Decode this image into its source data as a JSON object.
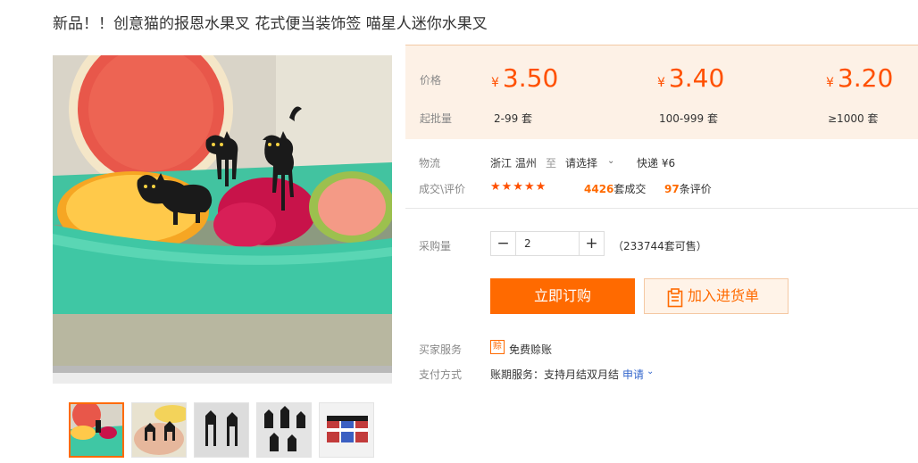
{
  "product": {
    "title": "新品！！创意猫的报恩水果叉 花式便当装饰签 喵星人迷你水果叉"
  },
  "gallery": {
    "thumbnails": [
      "thumb-1",
      "thumb-2",
      "thumb-3",
      "thumb-4",
      "thumb-5"
    ],
    "active_index": 0
  },
  "price_box": {
    "price_label": "价格",
    "moq_label": "起批量",
    "currency": "¥",
    "tiers": [
      {
        "price": "3.50",
        "range": "2-99 套"
      },
      {
        "price": "3.40",
        "range": "100-999 套"
      },
      {
        "price": "3.20",
        "range": "≥1000 套"
      }
    ]
  },
  "logistics": {
    "label": "物流",
    "origin": "浙江 温州",
    "to": "至",
    "destination": "请选择",
    "shipping": "快递 ¥6"
  },
  "sales": {
    "label": "成交\\评价",
    "rating_stars": 5,
    "sold_count": "4426",
    "sold_suffix": "套成交",
    "review_count": "97",
    "review_suffix": "条评价"
  },
  "purchase": {
    "label": "采购量",
    "minus": "−",
    "plus": "+",
    "quantity": "2",
    "stock_text": "（233744套可售）"
  },
  "actions": {
    "buy_now": "立即订购",
    "add_to_list": "加入进货单"
  },
  "services": {
    "buyer_label": "买家服务",
    "badge": "赊",
    "buyer_service": "免费赊账",
    "payment_label": "支付方式",
    "payment_text": "账期服务：支持月结双月结",
    "apply_link": "申请"
  },
  "colors": {
    "accent": "#ff6a00",
    "price": "#ff5000",
    "price_bg": "#fdf1e6",
    "link": "#3366cc"
  }
}
